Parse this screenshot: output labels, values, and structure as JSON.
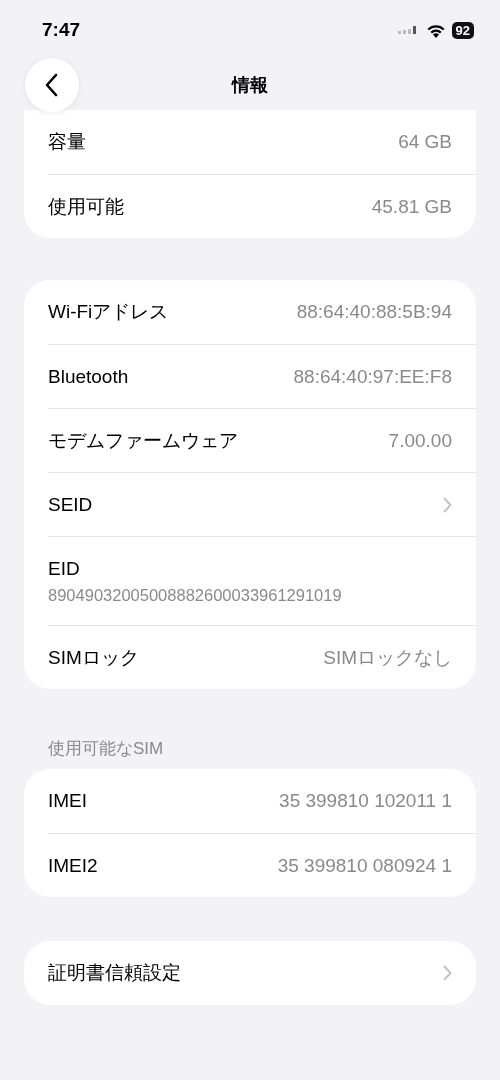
{
  "status_bar": {
    "time": "7:47",
    "battery": "92"
  },
  "nav_bar": {
    "title": "情報"
  },
  "groups": [
    {
      "rows": [
        {
          "kind": "value",
          "label": "容量",
          "value": "64 GB"
        },
        {
          "kind": "value",
          "label": "使用可能",
          "value": "45.81 GB"
        }
      ]
    },
    {
      "rows": [
        {
          "kind": "value",
          "label": "Wi-Fiアドレス",
          "value": "88:64:40:88:5B:94"
        },
        {
          "kind": "value",
          "label": "Bluetooth",
          "value": "88:64:40:97:EE:F8"
        },
        {
          "kind": "value",
          "label": "モデムファームウェア",
          "value": "7.00.00"
        },
        {
          "kind": "link",
          "label": "SEID"
        },
        {
          "kind": "stacked",
          "label": "EID",
          "value": "89049032005008882600033961291019"
        },
        {
          "kind": "value",
          "label": "SIMロック",
          "value": "SIMロックなし"
        }
      ]
    },
    {
      "header": "使用可能なSIM",
      "rows": [
        {
          "kind": "value",
          "label": "IMEI",
          "value": "35 399810 102011 1"
        },
        {
          "kind": "value",
          "label": "IMEI2",
          "value": "35 399810 080924 1"
        }
      ]
    },
    {
      "rows": [
        {
          "kind": "link",
          "label": "証明書信頼設定"
        }
      ]
    }
  ]
}
